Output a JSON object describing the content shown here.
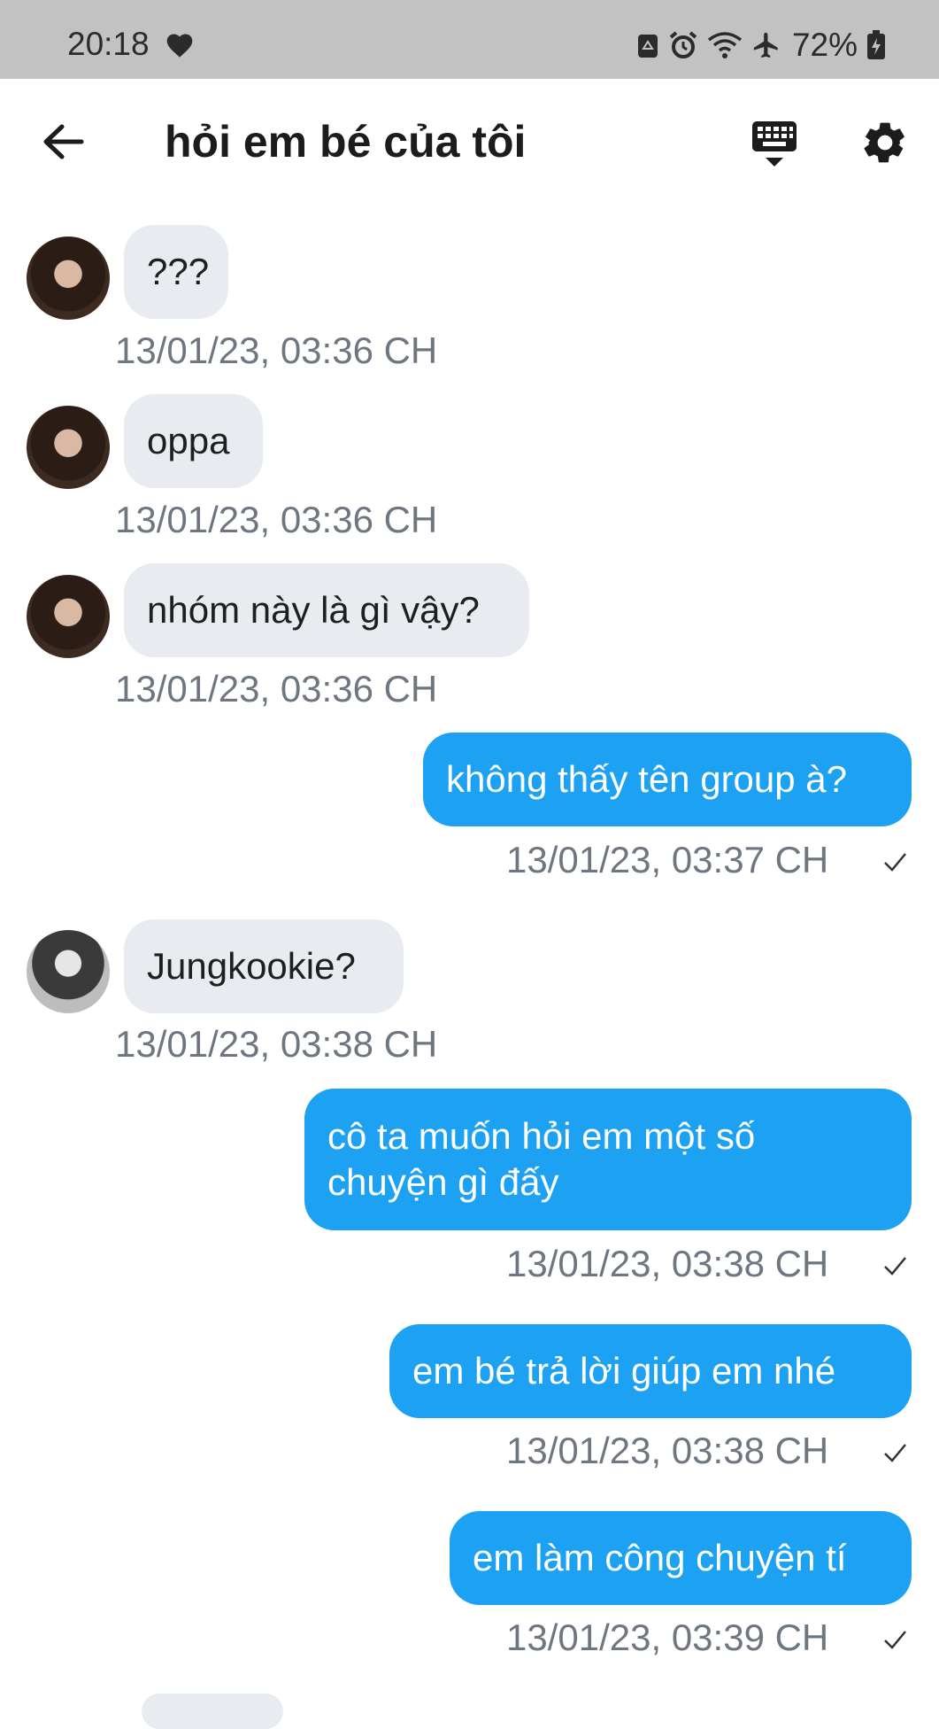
{
  "status_bar": {
    "time": "20:18",
    "battery": "72%"
  },
  "header": {
    "title": "hỏi em bé của tôi"
  },
  "messages": [
    {
      "text": "???",
      "time": "13/01/23, 03:36 CH"
    },
    {
      "text": "oppa",
      "time": "13/01/23, 03:36 CH"
    },
    {
      "text": "nhóm này là gì vậy?",
      "time": "13/01/23, 03:36 CH"
    },
    {
      "text": "không thấy tên group à?",
      "time": "13/01/23, 03:37 CH"
    },
    {
      "text": "Jungkookie?",
      "time": "13/01/23, 03:38 CH"
    },
    {
      "text": "cô ta muốn hỏi em một số chuyện gì đấy",
      "time": "13/01/23, 03:38 CH"
    },
    {
      "text": "em bé trả lời giúp em nhé",
      "time": "13/01/23, 03:38 CH"
    },
    {
      "text": "em làm công chuyện tí",
      "time": "13/01/23, 03:39 CH"
    }
  ],
  "colors": {
    "outgoing_bubble": "#1da1f2",
    "incoming_bubble": "#e8ecf0",
    "timestamp": "#6e7781"
  }
}
